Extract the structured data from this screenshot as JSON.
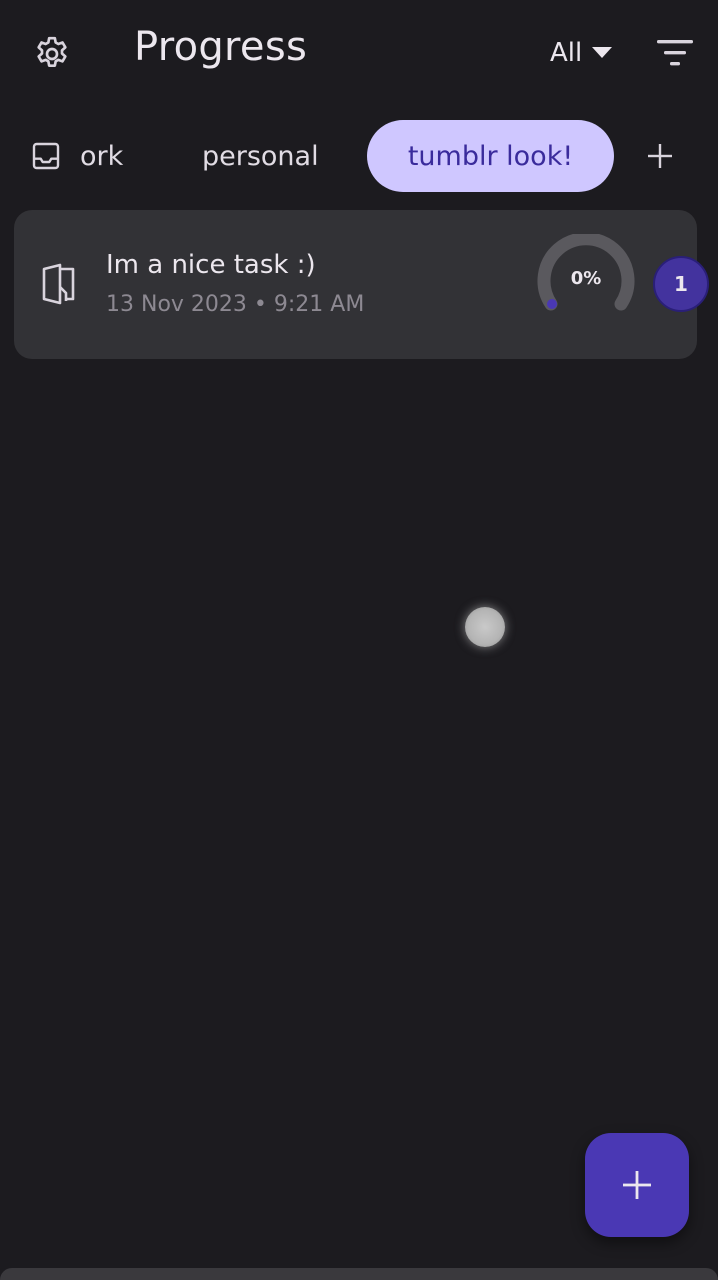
{
  "header": {
    "title": "Progress",
    "filter_value": "All",
    "icons": {
      "settings": "gear-icon",
      "filter_dropdown": "caret-down-icon",
      "sort": "sort-lines-icon"
    }
  },
  "tabs": [
    {
      "label": "ork",
      "icon": "inbox-icon",
      "selected": false
    },
    {
      "label": "personal",
      "selected": false
    },
    {
      "label": "tumblr look!",
      "selected": true
    }
  ],
  "add_tab_icon": "plus-icon",
  "tasks": [
    {
      "title": "Im a nice task :)",
      "meta": "13 Nov 2023 • 9:21 AM",
      "icon": "door-open-icon",
      "progress_label": "0%",
      "progress": 0,
      "subtask_count": "1"
    }
  ],
  "fab": {
    "icon": "plus-icon"
  },
  "colors": {
    "background": "#1c1b1f",
    "card": "#323236",
    "tab_selected_bg": "#cfc7ff",
    "tab_selected_text": "#3a2b9c",
    "accent": "#4a38b4",
    "badge": "#43339e"
  }
}
